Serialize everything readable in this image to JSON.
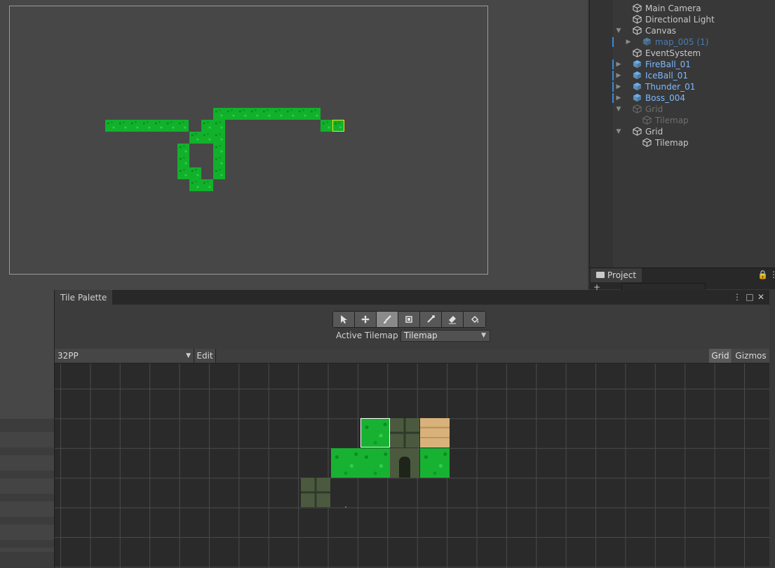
{
  "hierarchy": {
    "items": [
      {
        "label": "Main Camera",
        "state": "normal"
      },
      {
        "label": "Directional Light",
        "state": "normal"
      },
      {
        "label": "Canvas",
        "state": "normal"
      },
      {
        "label": "map_005 (1)",
        "state": "prefab-disabled"
      },
      {
        "label": "EventSystem",
        "state": "normal"
      },
      {
        "label": "FireBall_01",
        "state": "prefab"
      },
      {
        "label": "IceBall_01",
        "state": "prefab"
      },
      {
        "label": "Thunder_01",
        "state": "prefab"
      },
      {
        "label": "Boss_004",
        "state": "prefab"
      },
      {
        "label": "Grid",
        "state": "disabled"
      },
      {
        "label": "Tilemap",
        "state": "disabled"
      },
      {
        "label": "Grid",
        "state": "normal"
      },
      {
        "label": "Tilemap",
        "state": "normal"
      }
    ]
  },
  "project": {
    "tab_label": "Project"
  },
  "tile_palette": {
    "tab_label": "Tile Palette",
    "tools": [
      "select-tool-icon",
      "move-tool-icon",
      "brush-tool-icon",
      "box-fill-tool-icon",
      "picker-tool-icon",
      "eraser-tool-icon",
      "fill-tool-icon"
    ],
    "active_tool": "brush-tool-icon",
    "active_tilemap_label": "Active Tilemap",
    "active_tilemap_value": "Tilemap",
    "palette_name": "32PP",
    "edit_label": "Edit",
    "grid_label": "Grid",
    "gizmos_label": "Gizmos"
  },
  "colors": {
    "grass": "#18b232",
    "selection": "#f1e61a",
    "prefab_text": "#7fb8ff",
    "accent": "#3a8ad8"
  }
}
